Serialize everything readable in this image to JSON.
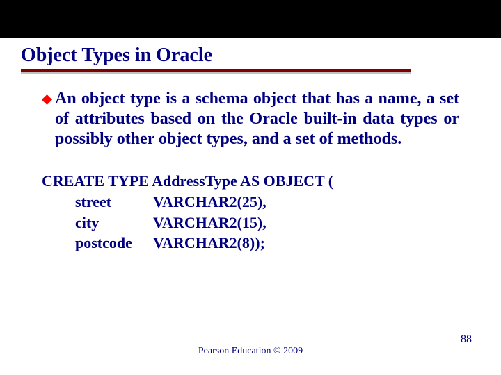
{
  "title": "Object Types in Oracle",
  "paragraph": "An object type is a schema object that has a name, a set of attributes based on the Oracle built-in data types or possibly other object types, and a set of methods.",
  "code": {
    "line1": "CREATE TYPE AddressType AS OBJECT (",
    "rows": [
      {
        "attr": "street",
        "type": "VARCHAR2(25),"
      },
      {
        "attr": "city",
        "type": "VARCHAR2(15),"
      },
      {
        "attr": "postcode",
        "type": "VARCHAR2(8));"
      }
    ]
  },
  "footer": "Pearson Education © 2009",
  "page": "88",
  "colors": {
    "text": "#000080",
    "rule": "#800000",
    "bullet": "#FF0000"
  }
}
